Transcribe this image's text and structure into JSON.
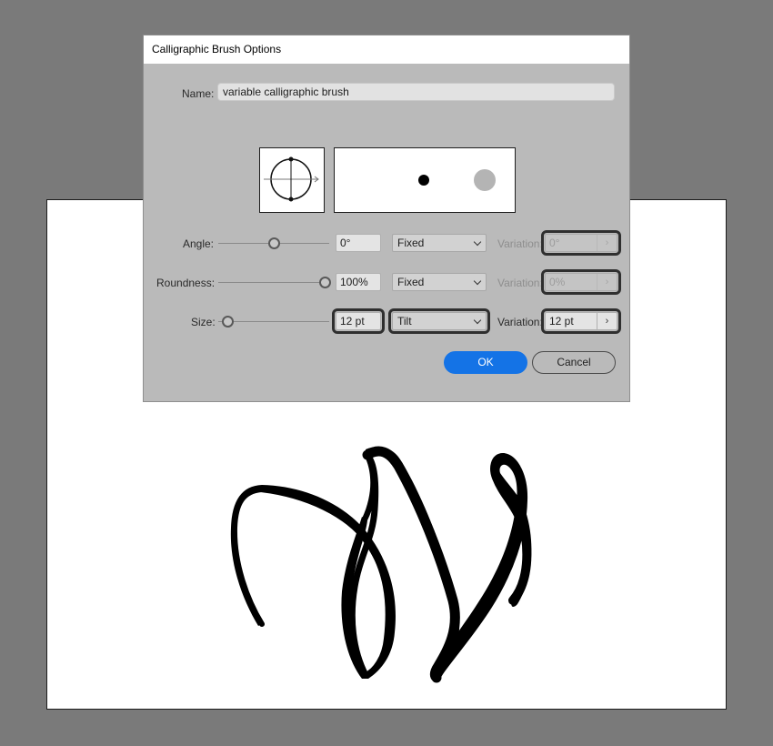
{
  "dialog": {
    "title": "Calligraphic Brush Options",
    "name_label": "Name:",
    "name_value": "variable calligraphic brush",
    "rows": [
      {
        "label": "Angle:",
        "value": "0°",
        "mode": "Fixed",
        "variation_label": "Variation:",
        "variation_value": "0°",
        "variation_enabled": false,
        "slider_fraction": 0.5
      },
      {
        "label": "Roundness:",
        "value": "100%",
        "mode": "Fixed",
        "variation_label": "Variation:",
        "variation_value": "0%",
        "variation_enabled": false,
        "slider_fraction": 1.0
      },
      {
        "label": "Size:",
        "value": "12 pt",
        "mode": "Tilt",
        "variation_label": "Variation:",
        "variation_value": "12 pt",
        "variation_enabled": true,
        "slider_fraction": 0.1
      }
    ],
    "ok_label": "OK",
    "cancel_label": "Cancel",
    "variation_arrow": "›"
  },
  "colors": {
    "ok_button": "#1473e6",
    "background": "#7a7a7a",
    "dialog": "#bababa",
    "artboard": "#ffffff",
    "stroke": "#000000"
  }
}
